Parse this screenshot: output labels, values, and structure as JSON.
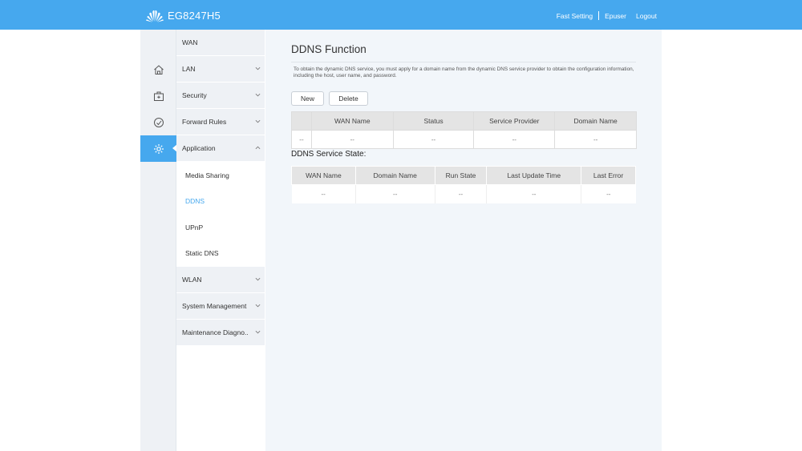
{
  "header": {
    "product_name": "EG8247H5",
    "links": {
      "fast_setting": "Fast Setting",
      "user": "Epuser",
      "logout": "Logout"
    },
    "brand_color": "#46a8ee"
  },
  "rail": {
    "icons": [
      "home-icon",
      "toolbox-icon",
      "speedometer-icon",
      "gear-icon"
    ],
    "active": "gear-icon"
  },
  "menu": {
    "items": [
      {
        "label": "WAN",
        "expandable": false
      },
      {
        "label": "LAN",
        "expandable": true
      },
      {
        "label": "Security",
        "expandable": true
      },
      {
        "label": "Forward Rules",
        "expandable": true
      },
      {
        "label": "Application",
        "expandable": true,
        "expanded": true
      },
      {
        "label": "WLAN",
        "expandable": true
      },
      {
        "label": "System Management",
        "expandable": true
      },
      {
        "label": "Maintenance Diagno..",
        "expandable": true
      }
    ],
    "sub_items": [
      {
        "label": "Media Sharing"
      },
      {
        "label": "DDNS",
        "active": true
      },
      {
        "label": "UPnP"
      },
      {
        "label": "Static DNS"
      }
    ]
  },
  "page": {
    "title": "DDNS Function",
    "description": "To obtain the dynamic DNS service, you must apply for a domain name from the dynamic DNS service provider to obtain the configuration information, including the host, user name, and password.",
    "buttons": {
      "new": "New",
      "delete": "Delete"
    },
    "ddns_table": {
      "headers": [
        "",
        "WAN Name",
        "Status",
        "Service Provider",
        "Domain Name"
      ],
      "rows": [
        [
          "--",
          "--",
          "--",
          "--",
          "--"
        ]
      ]
    },
    "state_title": "DDNS Service State:",
    "state_table": {
      "headers": [
        "WAN Name",
        "Domain Name",
        "Run State",
        "Last Update Time",
        "Last Error"
      ],
      "rows": [
        [
          "--",
          "--",
          "--",
          "--",
          "--"
        ]
      ]
    }
  }
}
